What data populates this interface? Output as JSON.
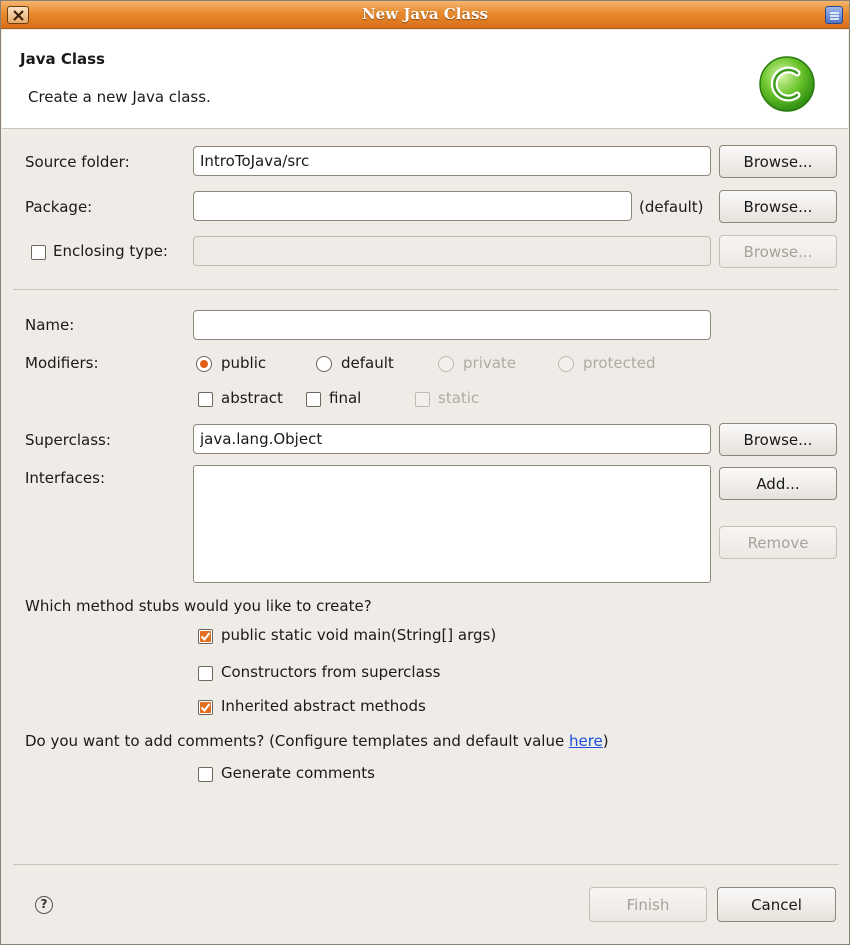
{
  "window": {
    "title": "New Java Class"
  },
  "header": {
    "title": "Java Class",
    "description": "Create a new Java class."
  },
  "source_folder": {
    "label": "Source folder:",
    "value": "IntroToJava/src",
    "browse": "Browse..."
  },
  "package": {
    "label": "Package:",
    "value": "",
    "default_hint": "(default)",
    "browse": "Browse..."
  },
  "enclosing_type": {
    "label": "Enclosing type:",
    "checked": false,
    "value": "",
    "browse": "Browse..."
  },
  "name": {
    "label": "Name:",
    "value": ""
  },
  "modifiers": {
    "label": "Modifiers:",
    "radios": {
      "public": "public",
      "default": "default",
      "private": "private",
      "protected": "protected"
    },
    "selected": "public",
    "checks": {
      "abstract": "abstract",
      "final": "final",
      "static": "static"
    }
  },
  "superclass": {
    "label": "Superclass:",
    "value": "java.lang.Object",
    "browse": "Browse..."
  },
  "interfaces": {
    "label": "Interfaces:",
    "add": "Add...",
    "remove": "Remove"
  },
  "stubs": {
    "question": "Which method stubs would you like to create?",
    "main": "public static void main(String[] args)",
    "constructors": "Constructors from superclass",
    "inherited": "Inherited abstract methods"
  },
  "comments": {
    "question_prefix": "Do you want to add comments? (Configure templates and default value ",
    "link": "here",
    "question_suffix": ")",
    "generate": "Generate comments"
  },
  "footer": {
    "help": "?",
    "finish": "Finish",
    "cancel": "Cancel"
  },
  "colors": {
    "titlebar": "#e88a2e",
    "accent_check": "#e07020",
    "link": "#1a4fd8"
  }
}
